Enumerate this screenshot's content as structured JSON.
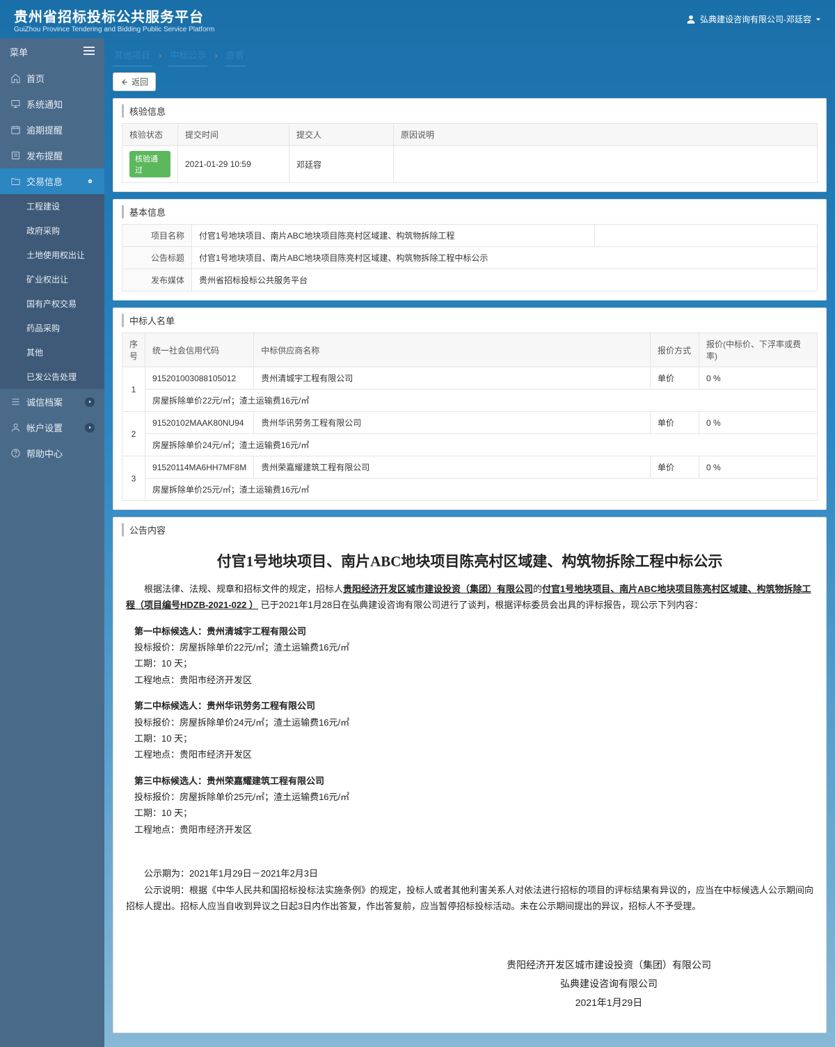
{
  "header": {
    "title_zh": "贵州省招标投标公共服务平台",
    "title_en": "GuiZhou Province Tendering and Bidding Public Service Platform",
    "user_company": "弘典建设咨询有限公司-邓廷容"
  },
  "sidebar": {
    "menu_label": "菜单",
    "items": [
      {
        "label": "首页"
      },
      {
        "label": "系统通知"
      },
      {
        "label": "逾期提醒"
      },
      {
        "label": "发布提醒"
      },
      {
        "label": "交易信息",
        "active": true
      },
      {
        "label": "诚信档案"
      },
      {
        "label": "帐户设置"
      },
      {
        "label": "帮助中心"
      }
    ],
    "sub_items": [
      {
        "label": "工程建设"
      },
      {
        "label": "政府采购"
      },
      {
        "label": "土地使用权出让"
      },
      {
        "label": "矿业权出让"
      },
      {
        "label": "国有产权交易"
      },
      {
        "label": "药品采购"
      },
      {
        "label": "其他"
      },
      {
        "label": "已发公告处理"
      }
    ]
  },
  "breadcrumb": {
    "c1": "其他项目",
    "c2": "中标公示",
    "c3": "查看"
  },
  "back_label": "返回",
  "verify": {
    "title": "核验信息",
    "cols": {
      "status": "核验状态",
      "time": "提交时间",
      "submitter": "提交人",
      "reason": "原因说明"
    },
    "row": {
      "status": "核验通过",
      "time": "2021-01-29 10:59",
      "submitter": "邓廷容",
      "reason": ""
    }
  },
  "basic": {
    "title": "基本信息",
    "k_project": "项目名称",
    "v_project": "付官1号地块项目、南片ABC地块项目陈亮村区域建、构筑物拆除工程",
    "k_notice": "公告标题",
    "v_notice": "付官1号地块项目、南片ABC地块项目陈亮村区域建、构筑物拆除工程中标公示",
    "k_media": "发布媒体",
    "v_media": "贵州省招标投标公共服务平台"
  },
  "bidders": {
    "title": "中标人名单",
    "cols": {
      "idx": "序号",
      "code": "统一社会信用代码",
      "name": "中标供应商名称",
      "method": "报价方式",
      "price": "报价(中标价、下浮率或费率)"
    },
    "rows": [
      {
        "idx": "1",
        "code": "915201003088105012",
        "name": "贵州清城宇工程有限公司",
        "method": "单价",
        "price": "0 %",
        "detail": "房屋拆除单价22元/㎡；渣土运输费16元/㎡"
      },
      {
        "idx": "2",
        "code": "91520102MAAK80NU94",
        "name": "贵州华讯劳务工程有限公司",
        "method": "单价",
        "price": "0 %",
        "detail": "房屋拆除单价24元/㎡；渣土运输费16元/㎡"
      },
      {
        "idx": "3",
        "code": "91520114MA6HH7MF8M",
        "name": "贵州荣嘉耀建筑工程有限公司",
        "method": "单价",
        "price": "0 %",
        "detail": "房屋拆除单价25元/㎡；渣土运输费16元/㎡"
      }
    ]
  },
  "notice": {
    "section_title": "公告内容",
    "title": "付官1号地块项目、南片ABC地块项目陈亮村区域建、构筑物拆除工程中标公示",
    "intro_pre": "根据法律、法规、规章和招标文件的规定，招标人",
    "intro_owner": "贵阳经济开发区城市建设投资（集团）有限公司",
    "intro_mid": "的",
    "intro_proj": "付官1号地块项目、南片ABC地块项目陈亮村区域建、构筑物拆除工程（项目编号HDZB-2021-022 ）",
    "intro_post": " 已于2021年1月28日在弘典建设咨询有限公司进行了谈判，根据评标委员会出具的评标报告，现公示下列内容：",
    "candidates": [
      {
        "rank_label": "第一中标候选人：贵州清城宇工程有限公司",
        "price": "投标报价：房屋拆除单价22元/㎡；渣土运输费16元/㎡",
        "duration": "工期：10 天；",
        "location": "工程地点：贵阳市经济开发区"
      },
      {
        "rank_label": "第二中标候选人：贵州华讯劳务工程有限公司",
        "price": "投标报价：房屋拆除单价24元/㎡；渣土运输费16元/㎡",
        "duration": "工期：10 天；",
        "location": "工程地点：贵阳市经济开发区"
      },
      {
        "rank_label": "第三中标候选人：贵州荣嘉耀建筑工程有限公司",
        "price": "投标报价：房屋拆除单价25元/㎡；渣土运输费16元/㎡",
        "duration": "工期：10 天；",
        "location": "工程地点：贵阳市经济开发区"
      }
    ],
    "period": "公示期为：2021年1月29日－2021年2月3日",
    "explain": "公示说明：根据《中华人民共和国招标投标法实施条例》的规定，投标人或者其他利害关系人对依法进行招标的项目的评标结果有异议的，应当在中标候选人公示期间向招标人提出。招标人应当自收到异议之日起3日内作出答复，作出答复前，应当暂停招标投标活动。未在公示期间提出的异议，招标人不予受理。",
    "sign1": "贵阳经济开发区城市建设投资（集团）有限公司",
    "sign2": "弘典建设咨询有限公司",
    "sign3": "2021年1月29日"
  }
}
